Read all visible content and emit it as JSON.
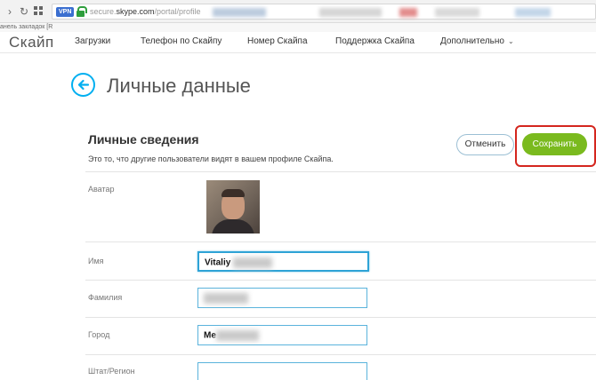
{
  "browser": {
    "url_prefix": "secure.",
    "url_host": "skype.com",
    "url_path": "/portal/profile",
    "vpn_badge": "VPN",
    "bookmarks_label": "анель закладок [R"
  },
  "site_nav": {
    "logo": "Скайп",
    "links": [
      {
        "label": "Загрузки"
      },
      {
        "label": "Телефон по Скайпу"
      },
      {
        "label": "Номер Скайпа"
      },
      {
        "label": "Поддержка Скайпа"
      },
      {
        "label": "Дополнительно"
      }
    ]
  },
  "page": {
    "title": "Личные данные"
  },
  "section": {
    "title": "Личные сведения",
    "subtitle": "Это то, что другие пользователи видят в вашем профиле Скайпа.",
    "cancel_label": "Отменить",
    "save_label": "Сохранить"
  },
  "fields": {
    "avatar_label": "Аватар",
    "first_name_label": "Имя",
    "first_name_value": "Vitaliy",
    "last_name_label": "Фамилия",
    "last_name_value": "",
    "city_label": "Город",
    "city_value": "Ме",
    "state_label": "Штат/Регион",
    "state_value": ""
  },
  "colors": {
    "accent": "#00aff0",
    "save_button": "#7aba1e",
    "highlight": "#d4261e"
  }
}
